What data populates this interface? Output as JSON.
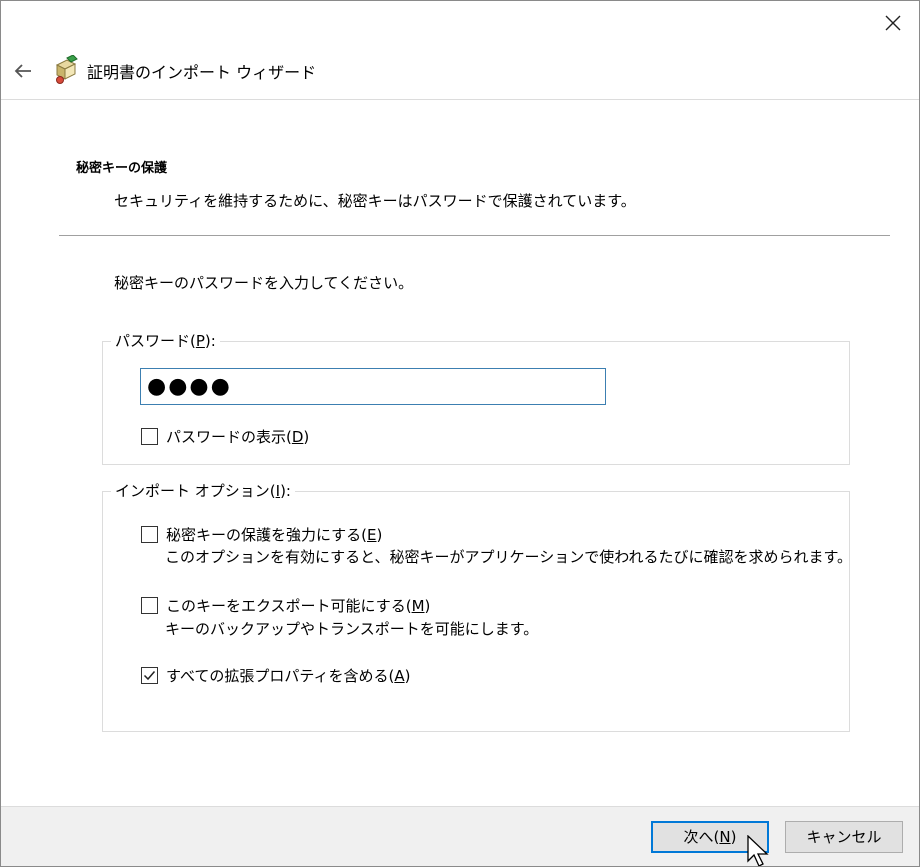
{
  "window": {
    "title": "証明書のインポート ウィザード"
  },
  "section": {
    "heading": "秘密キーの保護",
    "description": "セキュリティを維持するために、秘密キーはパスワードで保護されています。"
  },
  "instruction": "秘密キーのパスワードを入力してください。",
  "password_group": {
    "legend_prefix": "パスワード(",
    "legend_mnemonic": "P",
    "legend_suffix": "):",
    "value": "●●●●",
    "show_password": {
      "label_prefix": "パスワードの表示(",
      "mnemonic": "D",
      "label_suffix": ")",
      "checked": false
    }
  },
  "import_options": {
    "legend_prefix": "インポート オプション(",
    "legend_mnemonic": "I",
    "legend_suffix": "):",
    "options": [
      {
        "label_prefix": "秘密キーの保護を強力にする(",
        "mnemonic": "E",
        "label_suffix": ")",
        "description": "このオプションを有効にすると、秘密キーがアプリケーションで使われるたびに確認を求められます。",
        "checked": false
      },
      {
        "label_prefix": "このキーをエクスポート可能にする(",
        "mnemonic": "M",
        "label_suffix": ")",
        "description": "キーのバックアップやトランスポートを可能にします。",
        "checked": false
      },
      {
        "label_prefix": "すべての拡張プロパティを含める(",
        "mnemonic": "A",
        "label_suffix": ")",
        "description": "",
        "checked": true
      }
    ]
  },
  "footer": {
    "next_prefix": "次へ(",
    "next_mnemonic": "N",
    "next_suffix": ")",
    "cancel_label": "キャンセル"
  },
  "colors": {
    "accent": "#0078d7",
    "input_border": "#3c7fb1",
    "footer_bg": "#f0f0f0"
  },
  "icons": [
    "close-icon",
    "back-arrow-icon",
    "certificate-icon",
    "checkmark-icon",
    "mouse-cursor-icon"
  ]
}
